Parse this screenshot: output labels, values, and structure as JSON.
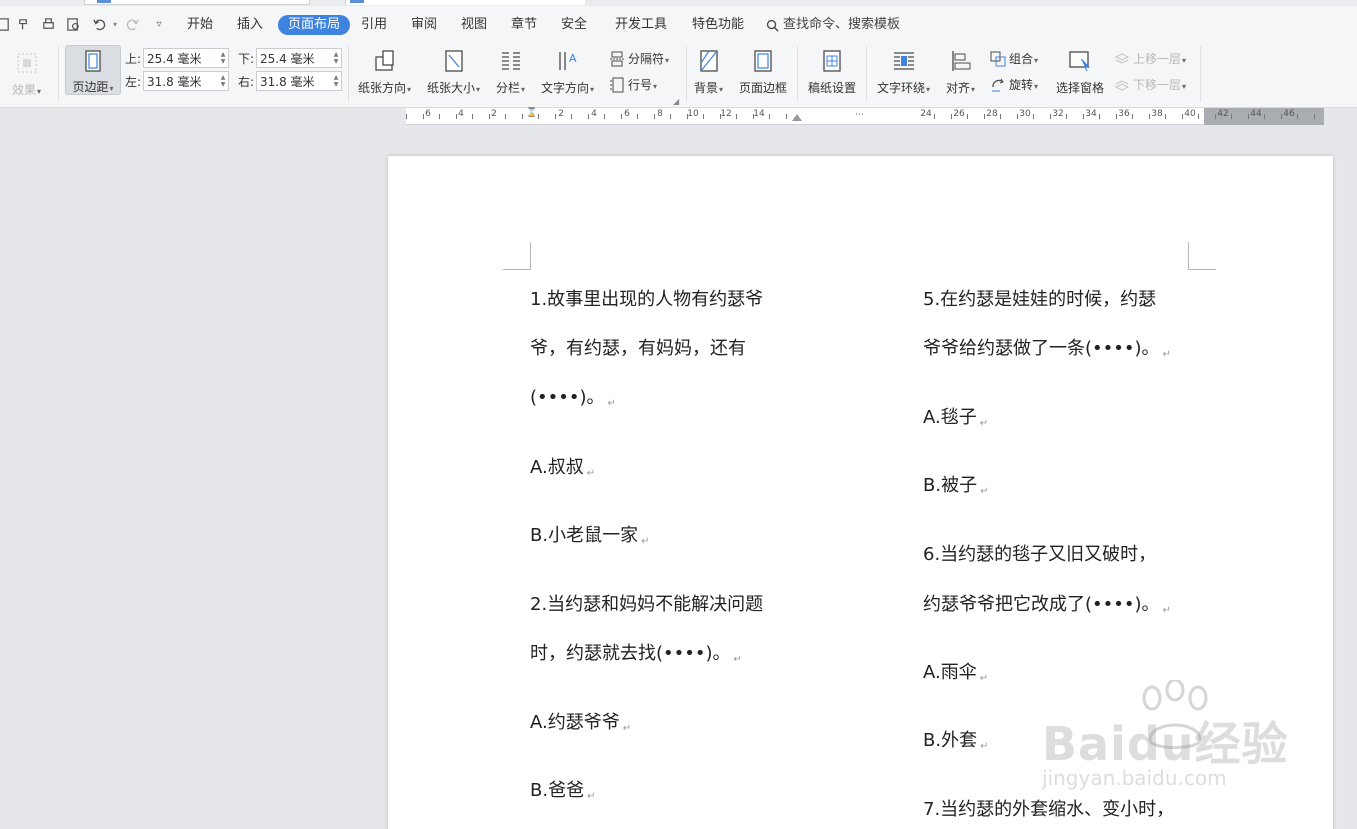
{
  "menu": {
    "items": [
      "开始",
      "插入",
      "页面布局",
      "引用",
      "审阅",
      "视图",
      "章节",
      "安全",
      "开发工具",
      "特色功能"
    ],
    "active_index": 2,
    "search": "查找命令、搜索模板"
  },
  "ribbon": {
    "effect": "效果",
    "margin": "页边距",
    "margins": {
      "top_label": "上:",
      "top_value": "25.4 毫米",
      "bottom_label": "下:",
      "bottom_value": "25.4 毫米",
      "left_label": "左:",
      "left_value": "31.8 毫米",
      "right_label": "右:",
      "right_value": "31.8 毫米"
    },
    "orientation": "纸张方向",
    "size": "纸张大小",
    "columns": "分栏",
    "text_direction": "文字方向",
    "breaks": "分隔符",
    "line_numbers": "行号",
    "background": "背景",
    "page_border": "页面边框",
    "manuscript": "稿纸设置",
    "wrap": "文字环绕",
    "align": "对齐",
    "group": "组合",
    "rotate": "旋转",
    "selection_pane": "选择窗格",
    "bring_forward": "上移一层",
    "send_backward": "下移一层"
  },
  "ruler": {
    "labels": [
      "6",
      "4",
      "2",
      "2",
      "4",
      "6",
      "8",
      "10",
      "12",
      "14",
      "24",
      "26",
      "28",
      "30",
      "32",
      "34",
      "36",
      "38",
      "40",
      "42",
      "44",
      "46"
    ]
  },
  "doc": {
    "left_col": [
      "1.故事里出现的人物有约瑟爷",
      "爷，有约瑟，有妈妈，还有",
      "(••••)。",
      "A.叔叔",
      "B.小老鼠一家",
      "2.当约瑟和妈妈不能解决问题",
      "时，约瑟就去找(••••)。",
      "A.约瑟爷爷",
      "B.爸爸"
    ],
    "right_col": [
      "5.在约瑟是娃娃的时候，约瑟",
      "爷爷给约瑟做了一条(••••)。",
      "A.毯子",
      "B.被子",
      "6.当约瑟的毯子又旧又破时，",
      "约瑟爷爷把它改成了(••••)。",
      "A.雨伞",
      "B.外套",
      "7.当约瑟的外套缩水、变小时，"
    ],
    "pilcrow": "↵"
  },
  "watermark": {
    "brand": "Baidu经验",
    "url": "jingyan.baidu.com"
  }
}
